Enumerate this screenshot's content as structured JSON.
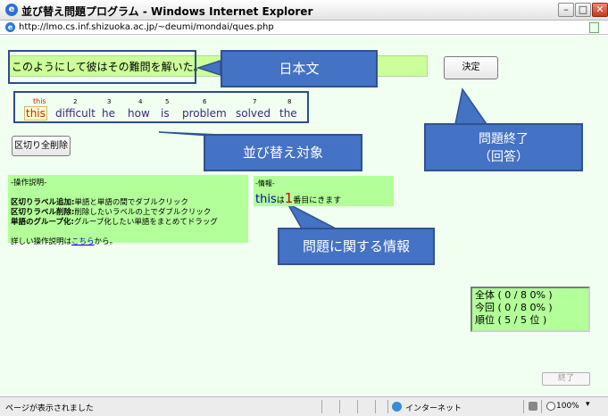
{
  "window": {
    "title": "並び替え問題プログラム - Windows Internet Explorer",
    "app_icon": "e",
    "minimize": "–",
    "maximize": "□",
    "close": "✕"
  },
  "address": {
    "url": "http://lmo.cs.inf.shizuoka.ac.jp/~deumi/mondai/ques.php"
  },
  "question": {
    "text": "このようにして彼はその難問を解いた。",
    "decide_label": "決定"
  },
  "words": [
    {
      "num": "this",
      "word": "this"
    },
    {
      "num": "2",
      "word": "difficult"
    },
    {
      "num": "3",
      "word": "he"
    },
    {
      "num": "4",
      "word": "how"
    },
    {
      "num": "5",
      "word": "is"
    },
    {
      "num": "6",
      "word": "problem"
    },
    {
      "num": "7",
      "word": "solved"
    },
    {
      "num": "8",
      "word": "the"
    }
  ],
  "clear_label": "区切り全削除",
  "callouts": {
    "nihonbun": "日本文",
    "end_line1": "問題終了",
    "end_line2": "（回答）",
    "target": "並び替え対象",
    "info": "問題に関する情報"
  },
  "instructions": {
    "header": "-操作説明-",
    "add_label": "区切りラベル追加:",
    "add_text": "単語と単語の間でダブルクリック",
    "del_label": "区切りラベル削除:",
    "del_text": "削除したいラベルの上でダブルクリック",
    "group_label": "単語のグループ化:",
    "group_text": "グループ化したい単語をまとめてドラッグ",
    "detail_prefix": "詳しい操作説明は",
    "detail_link": "こちら",
    "detail_suffix": "から。"
  },
  "info": {
    "header": "-情報-",
    "word": "this",
    "wa": "は",
    "num": "1",
    "suffix": "番目にきます"
  },
  "stats": {
    "total": "全体 ( 0 / 8 0% )",
    "current": "今回 ( 0 / 8 0% )",
    "rank": "順位 ( 5 / 5 位 )"
  },
  "finish_label": "終了",
  "statusbar": {
    "text": "ページが表示されました",
    "zone": "インターネット",
    "zoom": "100%",
    "zoom_arrow": "▾"
  }
}
